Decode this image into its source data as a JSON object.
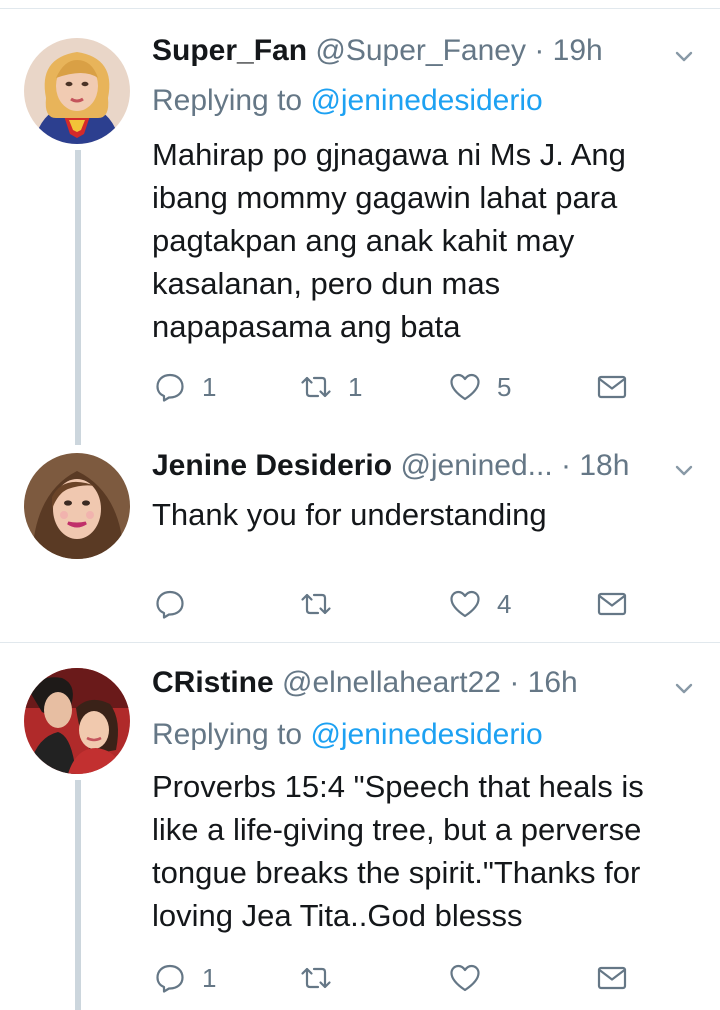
{
  "tweets": [
    {
      "name": "Super_Fan",
      "handle": "@Super_Faney",
      "sep": "·",
      "time": "19h",
      "replying_prefix": "Replying to ",
      "replying_mention": "@jeninedesiderio",
      "body_lines": [
        "Mahirap po gjnagawa ni Ms J. Ang",
        "ibang mommy gagawin lahat para",
        "pagtakpan ang anak kahit may",
        "kasalanan, pero dun mas",
        "napapasama ang bata"
      ],
      "replies": "1",
      "retweets": "1",
      "likes": "5",
      "avatar_icon": "avatar-supergirl"
    },
    {
      "name": "Jenine Desiderio",
      "handle": "@jenined...",
      "sep": "·",
      "time": "18h",
      "body_lines": [
        "Thank you for understanding"
      ],
      "replies": "",
      "retweets": "",
      "likes": "4",
      "avatar_icon": "avatar-woman"
    },
    {
      "name": "CRistine",
      "handle": "@elnellaheart22",
      "sep": "·",
      "time": "16h",
      "replying_prefix": "Replying to ",
      "replying_mention": "@jeninedesiderio",
      "body_lines": [
        "Proverbs 15:4 \"Speech that heals is",
        "like a life-giving tree, but a perverse",
        "tongue breaks the spirit.\"Thanks for",
        "loving Jea Tita..God blesss"
      ],
      "replies": "1",
      "retweets": "",
      "likes": "",
      "avatar_icon": "avatar-couple"
    }
  ],
  "colors": {
    "text": "#14171a",
    "muted": "#657786",
    "link": "#1da1f2",
    "thread_line": "#ccd6dd",
    "divider": "#e1e8ed"
  },
  "icons": [
    "reply-icon",
    "retweet-icon",
    "like-icon",
    "dm-icon",
    "chevron-down-icon"
  ]
}
